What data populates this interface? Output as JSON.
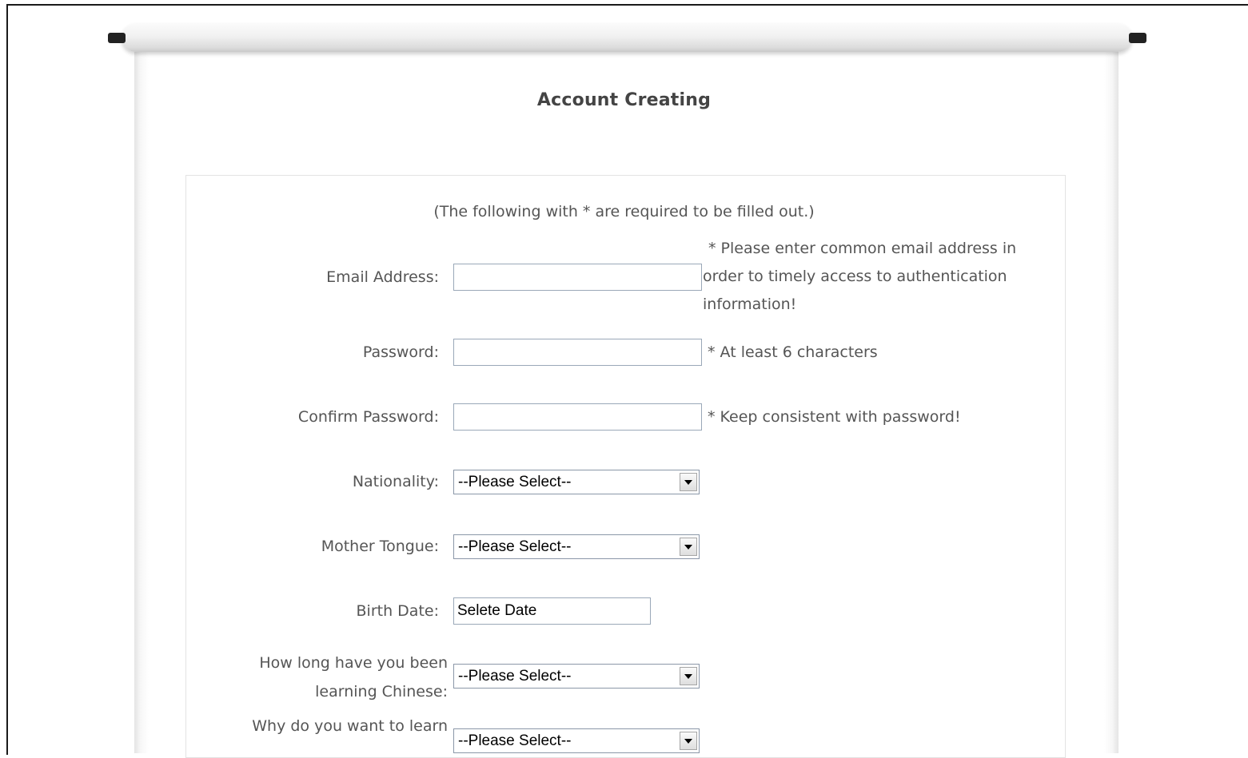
{
  "page": {
    "title": "Account Creating",
    "required_note": "(The following with * are required to be filled out.)"
  },
  "form": {
    "email": {
      "label": "Email Address:",
      "value": "",
      "hint": "* Please enter common email address in order to timely access to authentication information!"
    },
    "password": {
      "label": "Password:",
      "value": "",
      "hint": "* At least 6 characters"
    },
    "confirm_password": {
      "label": "Confirm Password:",
      "value": "",
      "hint": "* Keep consistent with password!"
    },
    "nationality": {
      "label": "Nationality:",
      "selected": "--Please Select--"
    },
    "mother_tongue": {
      "label": "Mother Tongue:",
      "selected": "--Please Select--"
    },
    "birth_date": {
      "label": "Birth Date:",
      "value": "Selete Date"
    },
    "learning_duration": {
      "label": "How long have you been learning Chinese:",
      "selected": "--Please Select--"
    },
    "learning_reason": {
      "label": "Why do you want to learn",
      "selected": "--Please Select--"
    }
  },
  "colors": {
    "text": "#555555",
    "input_border": "#9aa8b8"
  },
  "icons": {
    "dropdown": "chevron-down-icon"
  }
}
